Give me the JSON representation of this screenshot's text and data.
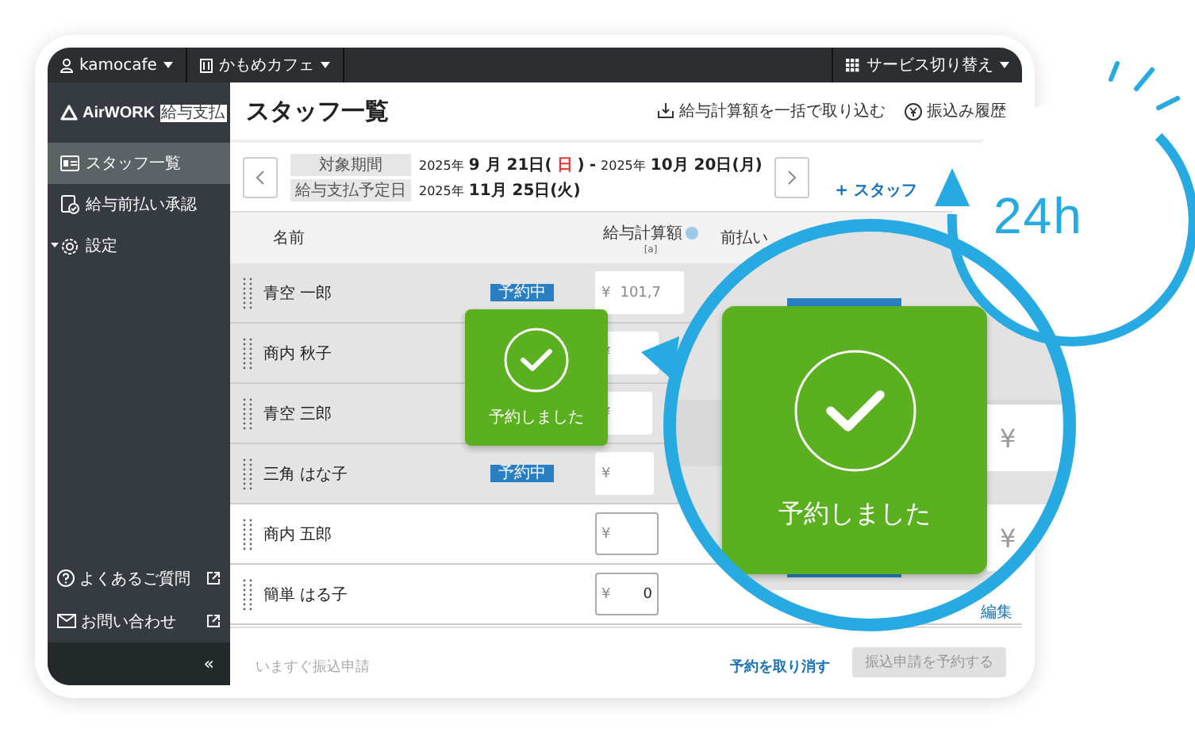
{
  "topbar": {
    "account": "kamocafe",
    "store": "かもめカフェ",
    "service_switch": "サービス切り替え"
  },
  "sidebar": {
    "logo": "AirWORK",
    "logo_badge": "給与支払",
    "items": [
      {
        "label": "スタッフ一覧",
        "selected": true
      },
      {
        "label": "給与前払い承認",
        "selected": false
      },
      {
        "label": "設定",
        "selected": false
      }
    ],
    "links": [
      "よくあるご質問",
      "お問い合わせ"
    ],
    "collapse": "«"
  },
  "header": {
    "title": "スタッフ一覧",
    "actions": [
      "給与計算額を一括で取り込む",
      "振込み履歴"
    ]
  },
  "period": {
    "target_label": "対象期間",
    "start_year": "2025年",
    "start_date": "9 月 21日(",
    "start_weekday": "日",
    "start_close": ")",
    "separator": "-",
    "end_year": "2025年",
    "end_date": "10月 20日(月)",
    "payday_label": "給与支払予定日",
    "payday_year": "2025年",
    "payday_date": "11月 25日(火)",
    "add_staff": "+ スタッフ"
  },
  "table": {
    "columns": [
      {
        "label": "名前"
      },
      {
        "label": "給与計算額",
        "note": "[a]",
        "help": true
      },
      {
        "label": "前払い"
      }
    ],
    "rows": [
      {
        "name": "青空 一郎",
        "scheduled": true,
        "badge": "予約中",
        "amount": "101,7"
      },
      {
        "name": "商内 秋子",
        "scheduled": true,
        "amount": ""
      },
      {
        "name": "青空 三郎",
        "scheduled": true,
        "amount": ""
      },
      {
        "name": "三角 はな子",
        "scheduled": true,
        "badge": "予約中",
        "amount": ""
      },
      {
        "name": "商内 五郎",
        "scheduled": false,
        "amount": ""
      },
      {
        "name": "簡単 はる子",
        "scheduled": false,
        "amount": "0",
        "edit": "編集"
      }
    ],
    "currency": "¥"
  },
  "footer": {
    "hint": "いますぐ振込申請",
    "cancel": "予約を取り消す",
    "submit": "振込申請を予約する"
  },
  "toast": {
    "message": "予約しました"
  },
  "magnifier": {
    "message": "予約しました",
    "currency": [
      "¥",
      "¥"
    ]
  },
  "clock": {
    "label": "24h"
  }
}
